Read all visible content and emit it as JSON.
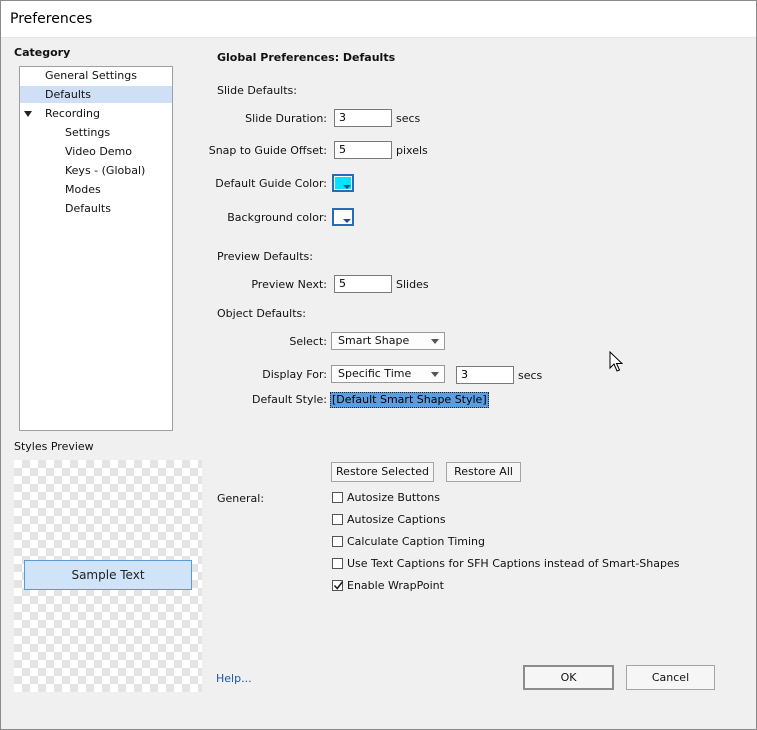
{
  "window": {
    "title": "Preferences"
  },
  "category": {
    "heading": "Category",
    "items": [
      {
        "label": "General Settings",
        "selected": false
      },
      {
        "label": "Defaults",
        "selected": true
      },
      {
        "label": "Recording",
        "expanded": true
      },
      {
        "label": "Settings"
      },
      {
        "label": "Video Demo"
      },
      {
        "label": "Keys - (Global)"
      },
      {
        "label": "Modes"
      },
      {
        "label": "Defaults"
      }
    ]
  },
  "styles_preview": {
    "heading": "Styles Preview",
    "sample_text": "Sample Text"
  },
  "main": {
    "heading": "Global Preferences: Defaults",
    "slide_defaults": {
      "heading": "Slide Defaults:",
      "slide_duration_label": "Slide Duration:",
      "slide_duration_value": "3",
      "slide_duration_unit": "secs",
      "snap_label": "Snap to Guide Offset:",
      "snap_value": "5",
      "snap_unit": "pixels",
      "guide_color_label": "Default Guide Color:",
      "guide_color": "#00e5ff",
      "background_color_label": "Background color:",
      "background_color": "#ffffff"
    },
    "preview_defaults": {
      "heading": "Preview Defaults:",
      "preview_next_label": "Preview Next:",
      "preview_next_value": "5",
      "preview_next_unit": "Slides"
    },
    "object_defaults": {
      "heading": "Object Defaults:",
      "select_label": "Select:",
      "select_value": "Smart Shape",
      "display_for_label": "Display For:",
      "display_for_value": "Specific Time",
      "display_time_value": "3",
      "display_time_unit": "secs",
      "default_style_label": "Default Style:",
      "default_style_value": "[Default Smart Shape Style]"
    },
    "restore_selected": "Restore Selected",
    "restore_all": "Restore All",
    "general": {
      "heading": "General:",
      "options": [
        {
          "label": "Autosize Buttons",
          "checked": false
        },
        {
          "label": "Autosize Captions",
          "checked": false
        },
        {
          "label": "Calculate Caption Timing",
          "checked": false
        },
        {
          "label": "Use Text Captions for SFH Captions instead of Smart-Shapes",
          "checked": false
        },
        {
          "label": "Enable WrapPoint",
          "checked": true
        }
      ]
    }
  },
  "footer": {
    "help": "Help...",
    "ok": "OK",
    "cancel": "Cancel"
  }
}
